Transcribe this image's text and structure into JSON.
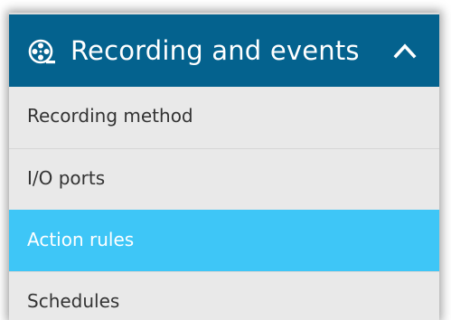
{
  "section": {
    "title": "Recording and events",
    "icon": "film-reel-icon",
    "toggle_icon": "chevron-up-icon",
    "expanded": true
  },
  "menu": {
    "items": [
      {
        "label": "Recording method",
        "active": false
      },
      {
        "label": "I/O ports",
        "active": false
      },
      {
        "label": "Action rules",
        "active": true
      },
      {
        "label": "Schedules",
        "active": false
      }
    ]
  },
  "colors": {
    "header_bg": "#04628e",
    "menu_bg": "#e9e9e9",
    "active_bg": "#3ec6f7",
    "text": "#333333",
    "header_text": "#ffffff"
  }
}
